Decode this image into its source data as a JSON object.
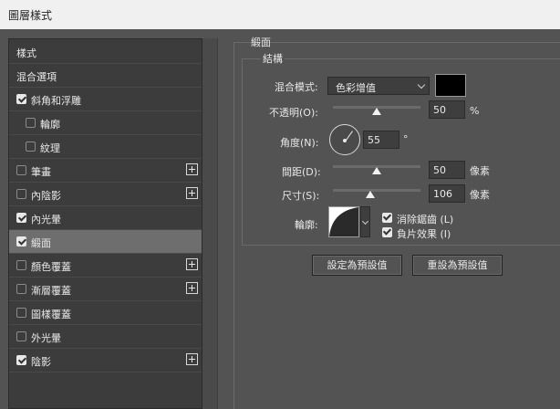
{
  "window": {
    "title": "圖層樣式"
  },
  "sidebar": {
    "items": [
      {
        "label": "樣式",
        "checkbox": null,
        "checked": false,
        "plus": false,
        "indent": false,
        "selected": false
      },
      {
        "label": "混合選項",
        "checkbox": null,
        "checked": false,
        "plus": false,
        "indent": false,
        "selected": false
      },
      {
        "label": "斜角和浮雕",
        "checkbox": true,
        "checked": true,
        "plus": false,
        "indent": false,
        "selected": false
      },
      {
        "label": "輪廓",
        "checkbox": true,
        "checked": false,
        "plus": false,
        "indent": true,
        "selected": false
      },
      {
        "label": "紋理",
        "checkbox": true,
        "checked": false,
        "plus": false,
        "indent": true,
        "selected": false
      },
      {
        "label": "筆畫",
        "checkbox": true,
        "checked": false,
        "plus": true,
        "indent": false,
        "selected": false
      },
      {
        "label": "內陰影",
        "checkbox": true,
        "checked": false,
        "plus": true,
        "indent": false,
        "selected": false
      },
      {
        "label": "內光暈",
        "checkbox": true,
        "checked": true,
        "plus": false,
        "indent": false,
        "selected": false
      },
      {
        "label": "緞面",
        "checkbox": true,
        "checked": true,
        "plus": false,
        "indent": false,
        "selected": true
      },
      {
        "label": "顏色覆蓋",
        "checkbox": true,
        "checked": false,
        "plus": true,
        "indent": false,
        "selected": false
      },
      {
        "label": "漸層覆蓋",
        "checkbox": true,
        "checked": false,
        "plus": true,
        "indent": false,
        "selected": false
      },
      {
        "label": "圖樣覆蓋",
        "checkbox": true,
        "checked": false,
        "plus": false,
        "indent": false,
        "selected": false
      },
      {
        "label": "外光暈",
        "checkbox": true,
        "checked": false,
        "plus": false,
        "indent": false,
        "selected": false
      },
      {
        "label": "陰影",
        "checkbox": true,
        "checked": true,
        "plus": true,
        "indent": false,
        "selected": false
      }
    ]
  },
  "panel": {
    "section_title": "緞面",
    "group_title": "結構",
    "blend_mode": {
      "label": "混合模式:",
      "value": "色彩增值",
      "color": "#000000"
    },
    "opacity": {
      "label": "不透明(O):",
      "value": "50",
      "unit": "%",
      "level": 0.5
    },
    "angle": {
      "label": "角度(N):",
      "value": "55",
      "unit": "°"
    },
    "distance": {
      "label": "間距(D):",
      "value": "50",
      "unit": "像素",
      "level": 0.5
    },
    "size": {
      "label": "尺寸(S):",
      "value": "106",
      "unit": "像素",
      "level": 0.43
    },
    "contour": {
      "label": "輪廓:"
    },
    "anti_alias": {
      "label": "消除鋸齒 (L)",
      "checked": true
    },
    "invert": {
      "label": "負片效果 (I)",
      "checked": true
    },
    "buttons": {
      "set_default": "設定為預設值",
      "reset_default": "重設為預設值"
    }
  }
}
